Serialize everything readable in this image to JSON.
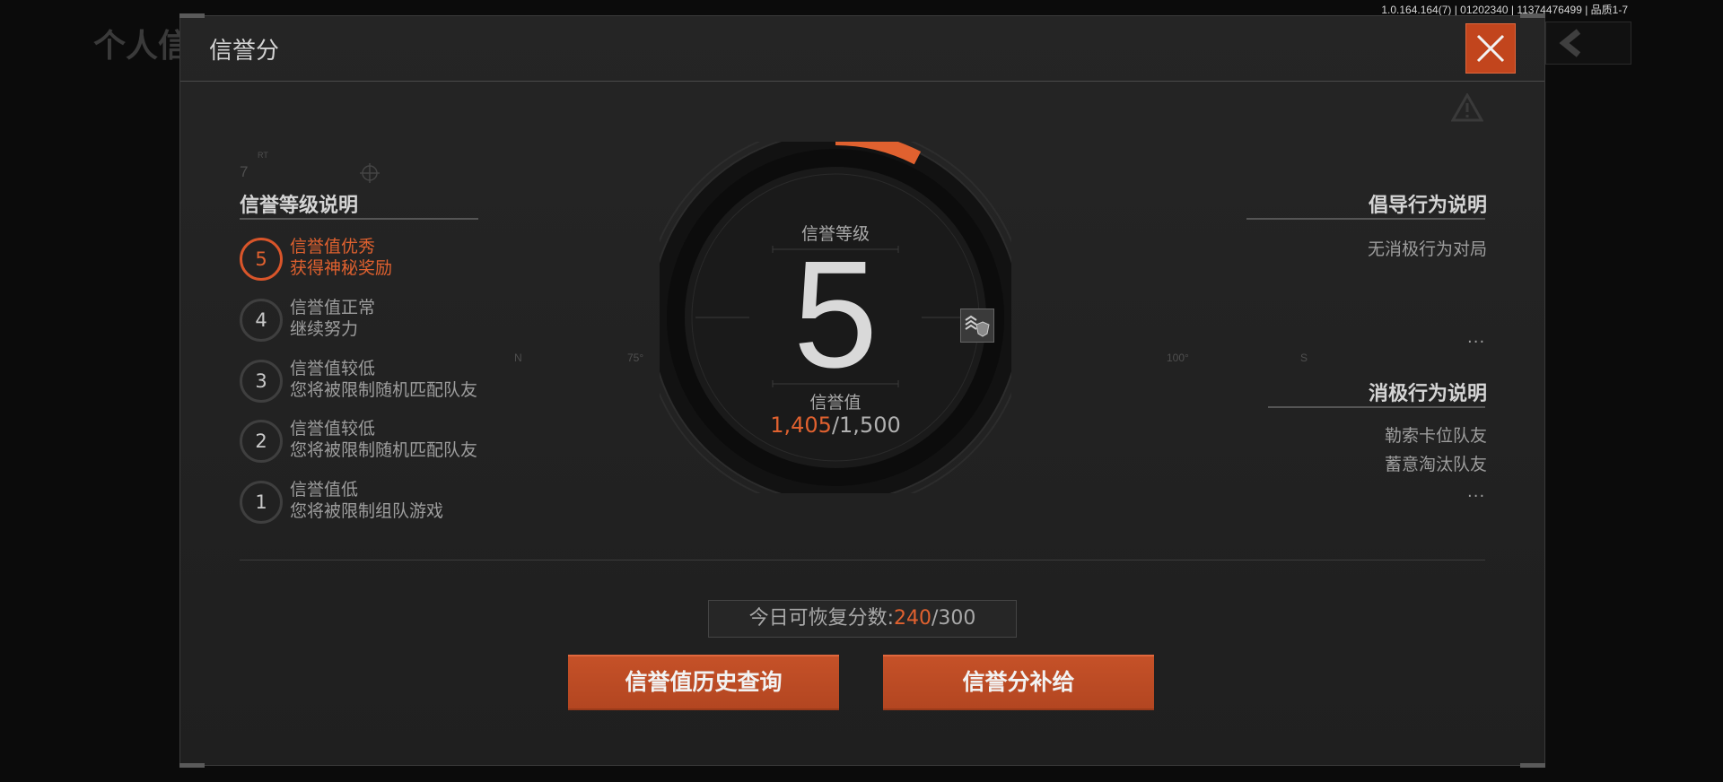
{
  "background": {
    "page_title": "个人信",
    "version_text": "1.0.164.164(7) | 01202340 | 11374476499 | 品质1-7"
  },
  "modal": {
    "title": "信誉分"
  },
  "levels": {
    "title": "信誉等级说明",
    "items": [
      {
        "num": "5",
        "line1": "信誉值优秀",
        "line2": "获得神秘奖励",
        "active": true
      },
      {
        "num": "4",
        "line1": "信誉值正常",
        "line2": "继续努力",
        "active": false
      },
      {
        "num": "3",
        "line1": "信誉值较低",
        "line2": "您将被限制随机匹配队友",
        "active": false
      },
      {
        "num": "2",
        "line1": "信誉值较低",
        "line2": "您将被限制随机匹配队友",
        "active": false
      },
      {
        "num": "1",
        "line1": "信誉值低",
        "line2": "您将被限制组队游戏",
        "active": false
      }
    ]
  },
  "dial": {
    "level_label": "信誉等级",
    "level": "5",
    "value_label": "信誉值",
    "current": "1,405",
    "max": "/1,500",
    "progress": 0.937
  },
  "positive": {
    "title": "倡导行为说明",
    "items": [
      "无消极行为对局"
    ],
    "more": "..."
  },
  "negative": {
    "title": "消极行为说明",
    "items": [
      "勒索卡位队友",
      "蓄意淘汰队友"
    ],
    "more": "..."
  },
  "decor": {
    "compass": [
      "N",
      "75°",
      "100°",
      "S"
    ],
    "corner_num": "7",
    "corner_sup": "RT"
  },
  "recover": {
    "label": "今日可恢复分数:",
    "current": "240",
    "max": "/300"
  },
  "buttons": {
    "history": "信誉值历史查询",
    "supply": "信誉分补给"
  },
  "colors": {
    "accent": "#e0612f",
    "button": "#c2451d"
  },
  "icons": {
    "close": "close-icon",
    "back": "chevron-left-icon",
    "badge": "rank-badge-icon",
    "warning": "warning-icon"
  }
}
